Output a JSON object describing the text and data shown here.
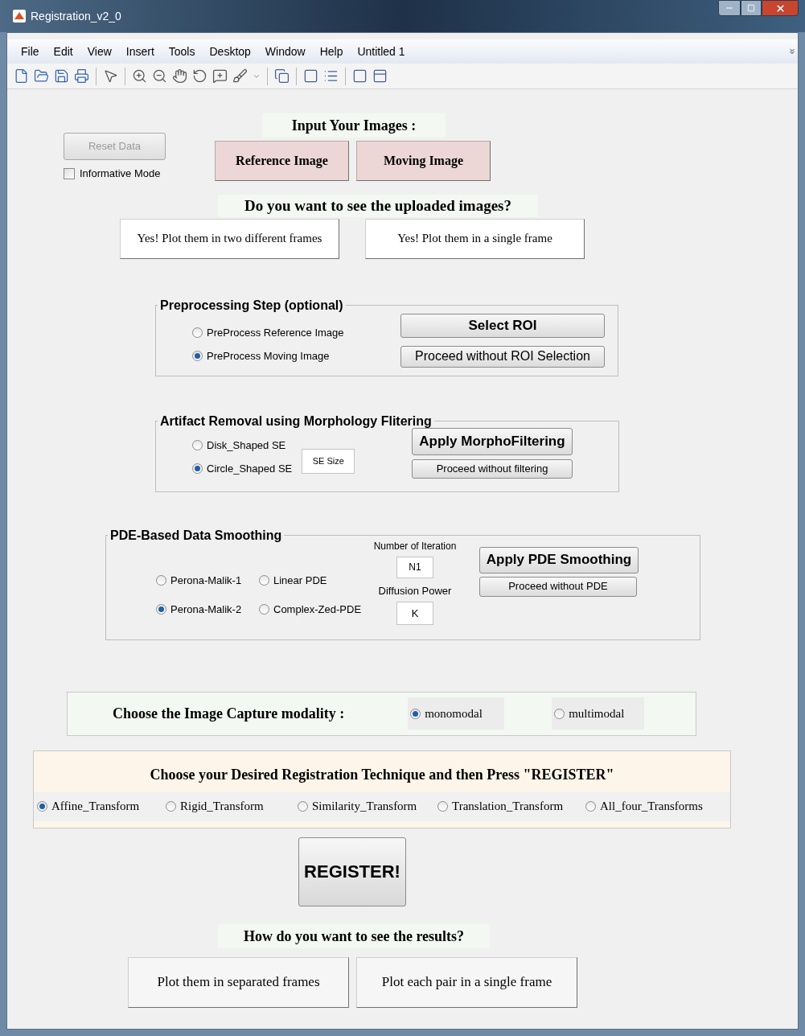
{
  "window": {
    "title": "Registration_v2_0"
  },
  "menu": [
    "File",
    "Edit",
    "View",
    "Insert",
    "Tools",
    "Desktop",
    "Window",
    "Help",
    "Untitled 1"
  ],
  "reset_button": {
    "label": "Reset Data",
    "disabled": true
  },
  "informative_mode": {
    "label": "Informative Mode",
    "checked": false
  },
  "input_heading": "Input Your Images :",
  "input_buttons": [
    "Reference Image",
    "Moving Image"
  ],
  "view_heading": "Do you want to see the uploaded images?",
  "view_buttons": [
    "Yes! Plot them in two different frames",
    "Yes! Plot them in a single frame"
  ],
  "preprocessing": {
    "title": "Preprocessing Step (optional)",
    "options": [
      {
        "label": "PreProcess Reference Image",
        "selected": false
      },
      {
        "label": "PreProcess Moving Image",
        "selected": true
      }
    ],
    "buttons": [
      "Select ROI",
      "Proceed without ROI Selection"
    ]
  },
  "artifact": {
    "title": "Artifact Removal using Morphology Flitering",
    "options": [
      {
        "label": "Disk_Shaped SE",
        "selected": false
      },
      {
        "label": "Circle_Shaped SE",
        "selected": true
      }
    ],
    "field": {
      "value": "SE Size"
    },
    "buttons": [
      "Apply MorphoFiltering",
      "Proceed without filtering"
    ]
  },
  "pde": {
    "title": "PDE-Based Data Smoothing",
    "options": [
      {
        "label": "Perona-Malik-1",
        "selected": false
      },
      {
        "label": "Linear PDE",
        "selected": false
      },
      {
        "label": "Perona-Malik-2",
        "selected": true
      },
      {
        "label": "Complex-Zed-PDE",
        "selected": false
      }
    ],
    "iteration_label": "Number of Iteration",
    "iteration_field": {
      "value": "N1"
    },
    "power_label": "Diffusion Power",
    "power_field": {
      "value": "K"
    },
    "buttons": [
      "Apply PDE Smoothing",
      "Proceed without PDE"
    ]
  },
  "modality": {
    "label": "Choose the Image Capture modality :",
    "options": [
      {
        "label": "monomodal",
        "selected": true
      },
      {
        "label": "multimodal",
        "selected": false
      }
    ]
  },
  "technique": {
    "heading": "Choose your Desired Registration Technique and then Press \"REGISTER\"",
    "options": [
      {
        "label": "Affine_Transform",
        "selected": true
      },
      {
        "label": "Rigid_Transform",
        "selected": false
      },
      {
        "label": "Similarity_Transform",
        "selected": false
      },
      {
        "label": "Translation_Transform",
        "selected": false
      },
      {
        "label": "All_four_Transforms",
        "selected": false
      }
    ]
  },
  "register_button": "REGISTER!",
  "results_heading": "How do you want to see the results?",
  "results_buttons": [
    "Plot them in separated frames",
    "Plot each pair in a single frame"
  ]
}
